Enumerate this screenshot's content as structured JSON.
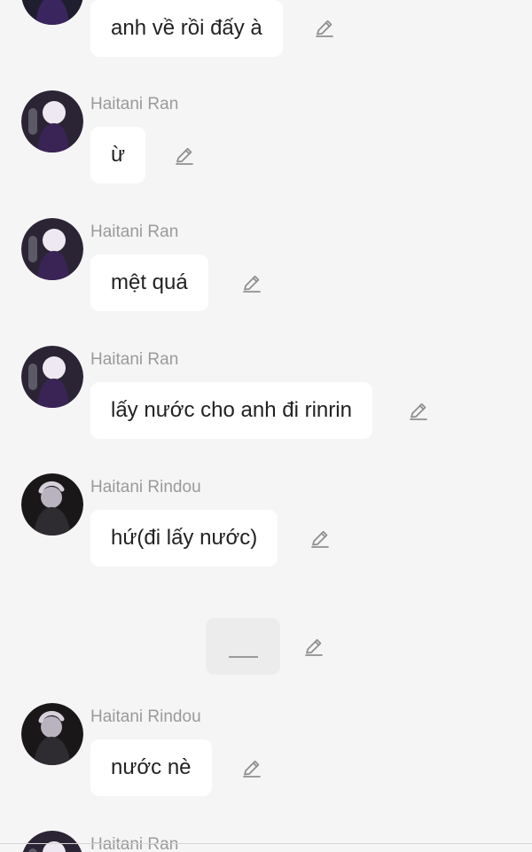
{
  "messages": [
    {
      "sender": "",
      "text": "anh về rồi đấy à",
      "avatar": "Ran"
    },
    {
      "sender": "Haitani Ran",
      "text": "ừ",
      "avatar": "Ran"
    },
    {
      "sender": "Haitani Ran",
      "text": "mệt quá",
      "avatar": "Ran"
    },
    {
      "sender": "Haitani Ran",
      "text": "lấy nước cho anh đi rinrin",
      "avatar": "Ran"
    },
    {
      "sender": "Haitani Rindou",
      "text": "hứ(đi lấy nước)",
      "avatar": "Rindou"
    },
    {
      "sender": "Haitani Rindou",
      "text": "nước nè",
      "avatar": "Rindou"
    },
    {
      "sender": "Haitani Ran",
      "text": "",
      "avatar": "Ran"
    }
  ],
  "action_bubble": {
    "text": "___"
  },
  "icons": {
    "edit": "pencil-icon",
    "avatar": "profile-avatar-icon"
  },
  "colors": {
    "background": "#f5f5f5",
    "bubble": "#ffffff",
    "name": "#9a9a9a",
    "text": "#222222",
    "icon": "#8f8f8f"
  }
}
